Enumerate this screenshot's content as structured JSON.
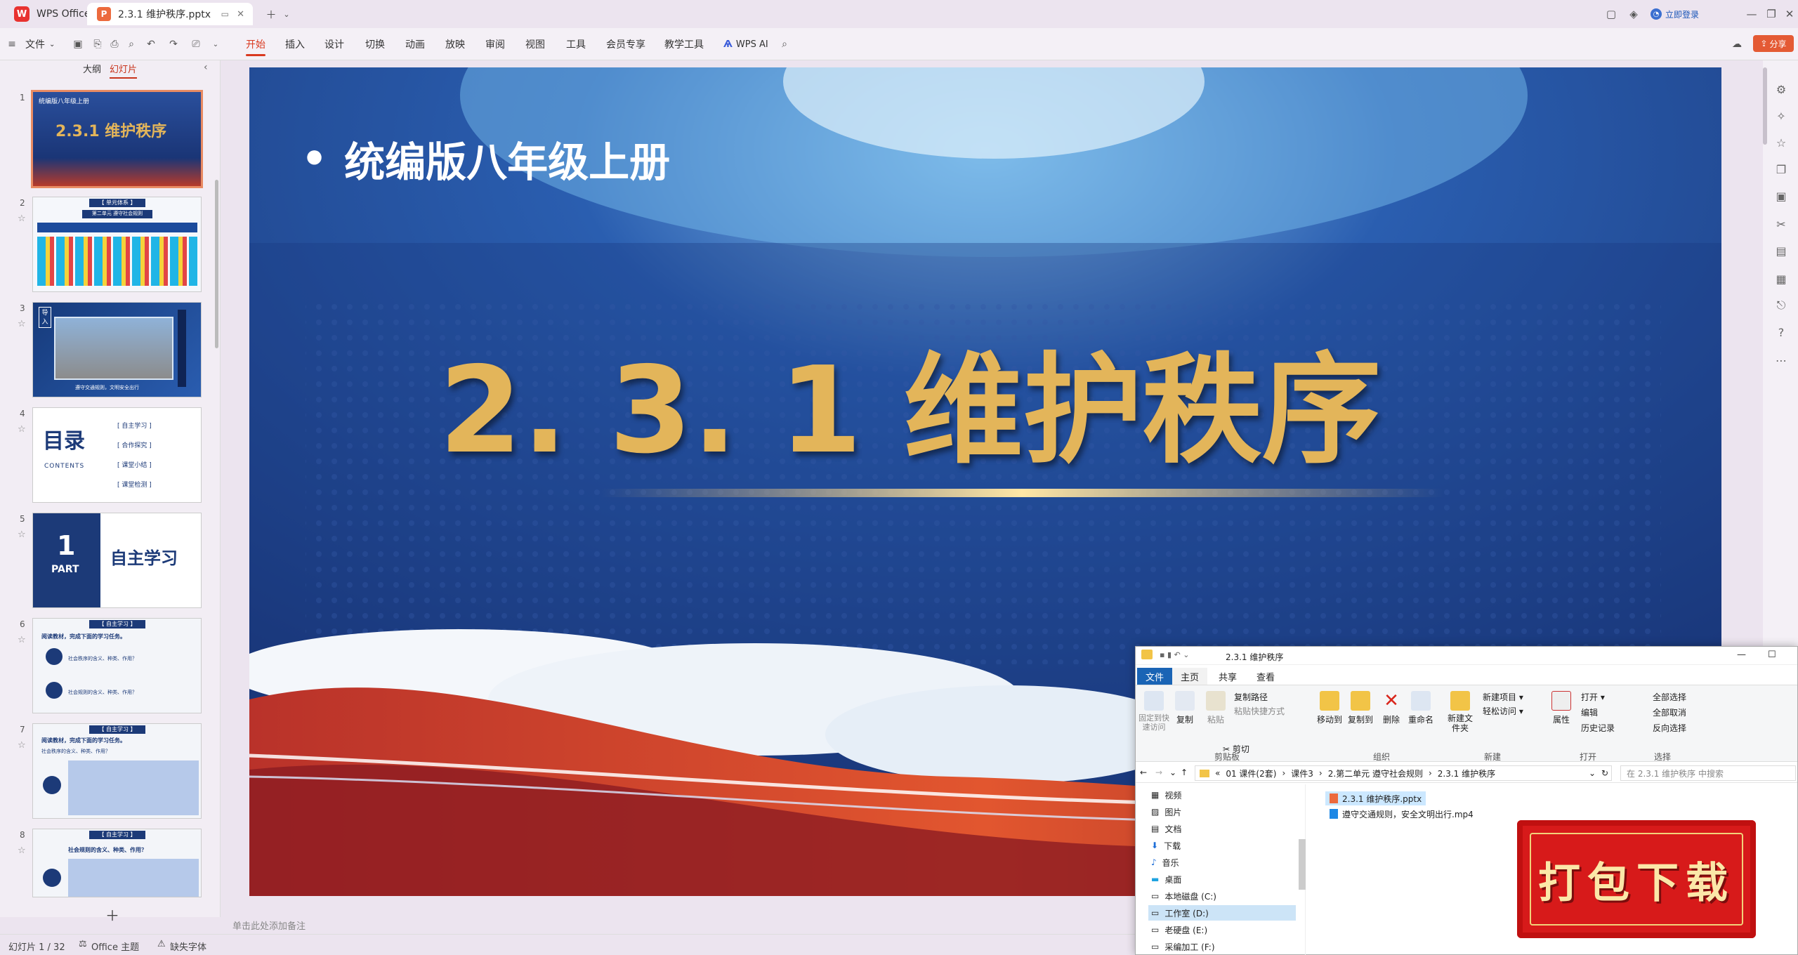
{
  "titlebar": {
    "app_name": "WPS Office",
    "doc_tab": "2.3.1 维护秩序.pptx",
    "login": "立即登录"
  },
  "menu": {
    "file": "文件",
    "items": [
      "开始",
      "插入",
      "设计",
      "切换",
      "动画",
      "放映",
      "审阅",
      "视图",
      "工具",
      "会员专享",
      "教学工具"
    ],
    "wps_ai": "WPS AI",
    "share": "分享"
  },
  "leftpanel": {
    "tab_outline": "大纲",
    "tab_slides": "幻灯片",
    "thumbs": [
      {
        "num": "1",
        "line1": "统编版八年级上册",
        "title": "2.3.1 维护秩序"
      },
      {
        "num": "2",
        "title": "【 单元体系 】",
        "sub": "第二单元 遵守社会规则"
      },
      {
        "num": "3",
        "badge": "导入",
        "caption": "遵守交通规则，文明安全出行"
      },
      {
        "num": "4",
        "title": "目录",
        "subtitle": "CONTENTS",
        "items": [
          "自主学习",
          "合作探究",
          "课堂小结",
          "课堂检测"
        ]
      },
      {
        "num": "5",
        "big": "1",
        "part": "PART",
        "title": "自主学习"
      },
      {
        "num": "6",
        "title": "【 自主学习 】",
        "line": "阅读教材，完成下面的学习任务。",
        "q1": "社会秩序的含义、种类、作用？",
        "q2": "社会规则的含义、种类、作用？"
      },
      {
        "num": "7",
        "title": "【 自主学习 】",
        "line": "阅读教材，完成下面的学习任务。",
        "q": "社会秩序的含义、种类、作用？"
      },
      {
        "num": "8",
        "title": "【 自主学习 】",
        "q": "社会规则的含义、种类、作用？"
      }
    ]
  },
  "slide": {
    "bullet": "统编版八年级上册",
    "title": "2. 3. 1 维护秩序"
  },
  "notes": "单击此处添加备注",
  "status": {
    "slide_count": "幻灯片 1 / 32",
    "theme": "Office 主题",
    "font": "缺失字体"
  },
  "explorer": {
    "title": "2.3.1 维护秩序",
    "tabs": [
      "文件",
      "主页",
      "共享",
      "查看"
    ],
    "groups": {
      "clipboard": "剪贴板",
      "organize": "组织",
      "new": "新建",
      "open": "打开",
      "select": "选择"
    },
    "buttons": {
      "pin": "固定到快速访问",
      "copy": "复制",
      "paste": "粘贴",
      "copy_path": "复制路径",
      "paste_shortcut": "粘贴快捷方式",
      "cut": "剪切",
      "move_to": "移动到",
      "copy_to": "复制到",
      "delete": "删除",
      "rename": "重命名",
      "new_folder": "新建文件夹",
      "new_item": "新建项目",
      "easy_access": "轻松访问",
      "properties": "属性",
      "open": "打开",
      "edit": "编辑",
      "history": "历史记录",
      "select_all": "全部选择",
      "select_none": "全部取消",
      "invert": "反向选择"
    },
    "path": [
      "01 课件(2套)",
      "课件3",
      "2.第二单元 遵守社会规则",
      "2.3.1 维护秩序"
    ],
    "search_placeholder": "在 2.3.1 维护秩序 中搜索",
    "nav": [
      "视频",
      "图片",
      "文档",
      "下载",
      "音乐",
      "桌面",
      "本地磁盘 (C:)",
      "工作室 (D:)",
      "老硬盘 (E:)",
      "采编加工 (F:)"
    ],
    "files": [
      "2.3.1 维护秩序.pptx",
      "遵守交通规则，安全文明出行.mp4"
    ]
  },
  "badge": "打包下载",
  "colors": {
    "accent": "#d9391f",
    "slide_gold": "#e3b55a",
    "slide_blue": "#1f3f8a"
  }
}
